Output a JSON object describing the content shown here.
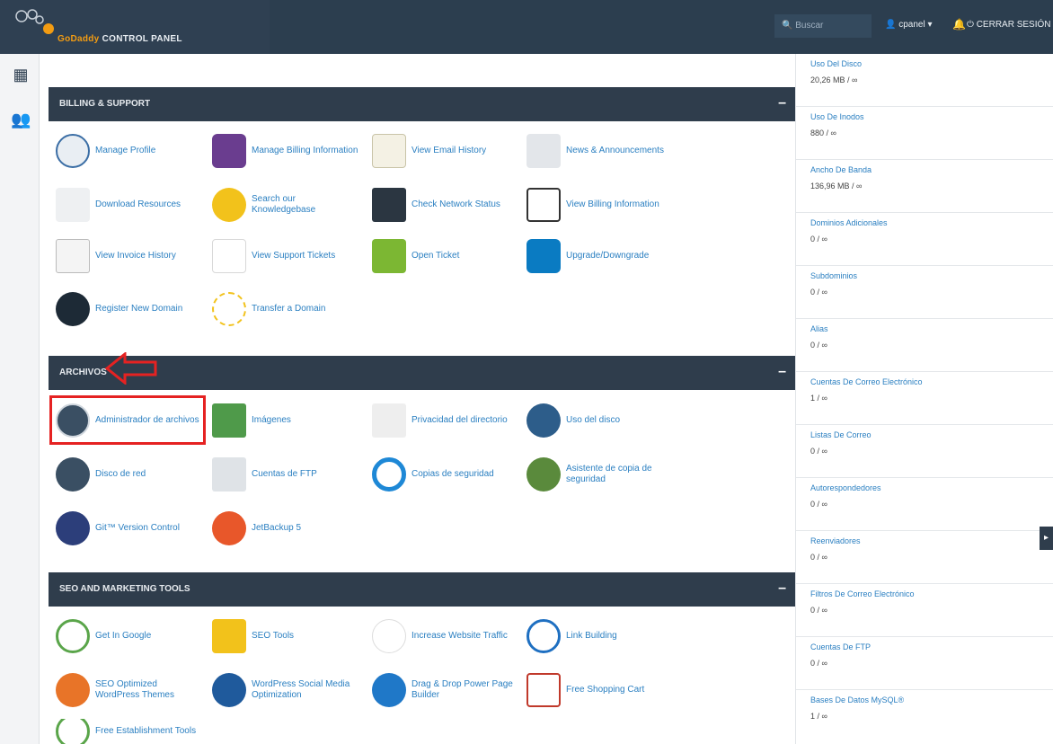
{
  "header": {
    "brand": "GoDaddy",
    "title": "CONTROL PANEL",
    "search_placeholder": "Buscar",
    "user": "cpanel",
    "logout": "CERRAR SESIÓN"
  },
  "sections": [
    {
      "title": "BILLING & SUPPORT",
      "items": [
        {
          "label": "Manage Profile",
          "icon": "profile-icon"
        },
        {
          "label": "Manage Billing Information",
          "icon": "credit-card-icon"
        },
        {
          "label": "View Email History",
          "icon": "email-history-icon"
        },
        {
          "label": "News & Announcements",
          "icon": "megaphone-icon"
        },
        {
          "label": "Download Resources",
          "icon": "download-icon"
        },
        {
          "label": "Search our Knowledgebase",
          "icon": "lightbulb-icon"
        },
        {
          "label": "Check Network Status",
          "icon": "network-status-icon"
        },
        {
          "label": "View Billing Information",
          "icon": "billing-icon"
        },
        {
          "label": "View Invoice History",
          "icon": "invoice-icon"
        },
        {
          "label": "View Support Tickets",
          "icon": "support-tickets-icon"
        },
        {
          "label": "Open Ticket",
          "icon": "open-ticket-icon"
        },
        {
          "label": "Upgrade/Downgrade",
          "icon": "upgrade-icon"
        },
        {
          "label": "Register New Domain",
          "icon": "domain-icon"
        },
        {
          "label": "Transfer a Domain",
          "icon": "transfer-domain-icon"
        }
      ]
    },
    {
      "title": "ARCHIVOS",
      "items": [
        {
          "label": "Administrador de archivos",
          "icon": "file-manager-icon"
        },
        {
          "label": "Imágenes",
          "icon": "images-icon"
        },
        {
          "label": "Privacidad del directorio",
          "icon": "directory-privacy-icon"
        },
        {
          "label": "Uso del disco",
          "icon": "disk-usage-icon"
        },
        {
          "label": "Disco de red",
          "icon": "web-disk-icon"
        },
        {
          "label": "Cuentas de FTP",
          "icon": "ftp-icon"
        },
        {
          "label": "Copias de seguridad",
          "icon": "backup-icon"
        },
        {
          "label": "Asistente de copia de seguridad",
          "icon": "backup-wizard-icon"
        },
        {
          "label": "Git™ Version Control",
          "icon": "git-icon"
        },
        {
          "label": "JetBackup 5",
          "icon": "jetbackup-icon"
        }
      ]
    },
    {
      "title": "SEO AND MARKETING TOOLS",
      "items": [
        {
          "label": "Get In Google",
          "icon": "google-icon"
        },
        {
          "label": "SEO Tools",
          "icon": "seo-tools-icon"
        },
        {
          "label": "Increase Website Traffic",
          "icon": "traffic-icon"
        },
        {
          "label": "Link Building",
          "icon": "link-icon"
        },
        {
          "label": "SEO Optimized WordPress Themes",
          "icon": "wp-themes-icon"
        },
        {
          "label": "WordPress Social Media Optimization",
          "icon": "wp-social-icon"
        },
        {
          "label": "Drag & Drop Power Page Builder",
          "icon": "page-builder-icon"
        },
        {
          "label": "Free Shopping Cart",
          "icon": "cart-icon"
        },
        {
          "label": "Free Establishment Tools",
          "icon": "dollar-icon"
        }
      ]
    }
  ],
  "stats": [
    {
      "name": "Uso Del Disco",
      "value": "20,26 MB / ∞"
    },
    {
      "name": "Uso De Inodos",
      "value": "880 / ∞"
    },
    {
      "name": "Ancho De Banda",
      "value": "136,96 MB / ∞"
    },
    {
      "name": "Dominios Adicionales",
      "value": "0 / ∞"
    },
    {
      "name": "Subdominios",
      "value": "0 / ∞"
    },
    {
      "name": "Alias",
      "value": "0 / ∞"
    },
    {
      "name": "Cuentas De Correo Electrónico",
      "value": "1 / ∞"
    },
    {
      "name": "Listas De Correo",
      "value": "0 / ∞"
    },
    {
      "name": "Autorespondedores",
      "value": "0 / ∞"
    },
    {
      "name": "Reenviadores",
      "value": "0 / ∞"
    },
    {
      "name": "Filtros De Correo Electrónico",
      "value": "0 / ∞"
    },
    {
      "name": "Cuentas De FTP",
      "value": "0 / ∞"
    },
    {
      "name": "Bases De Datos MySQL®",
      "value": "1 / ∞"
    }
  ],
  "colors": {
    "topbar": "#2c3e4f",
    "panel_header": "#2f3d4c",
    "link": "#2a7fc1",
    "highlight": "#e52222"
  }
}
